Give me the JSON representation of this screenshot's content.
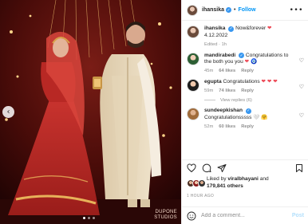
{
  "post": {
    "username": "ihansika",
    "follow_label": "Follow",
    "separator": "•",
    "more_label": "•••"
  },
  "caption": {
    "username": "ihansika",
    "text": "Now&forever ",
    "heart": "❤",
    "date": "4.12.2022",
    "meta": "Edited · 1h"
  },
  "comments": [
    {
      "username": "mandirabedi",
      "text": "Congratulations to the both you you ",
      "emoji": [
        "❤",
        "🧿"
      ],
      "time": "45m",
      "likes": "64 likes",
      "reply_label": "Reply"
    },
    {
      "username": "egupta",
      "text": "Congratulations ",
      "emoji": [
        "❤",
        "❤",
        "❤"
      ],
      "time": "59m",
      "likes": "74 likes",
      "reply_label": "Reply",
      "view_replies": "View replies (6)"
    },
    {
      "username": "sundeepkishan",
      "text": "Congratulationsssss ",
      "emoji": [
        "🤍",
        "🤗"
      ],
      "time": "52m",
      "likes": "60 likes",
      "reply_label": "Reply"
    }
  ],
  "likes": {
    "prefix": "Liked by ",
    "user": "viralbhayani",
    "and": " and",
    "count": "179,841 others"
  },
  "timestamp": "1 HOUR AGO",
  "add_comment": {
    "placeholder": "Add a comment...",
    "post_label": "Post"
  },
  "carousel": {
    "prev_icon": "chevron-left-icon",
    "slides": 3,
    "active_slide": 1,
    "watermark": "DUPONE\nSTUDIOS"
  },
  "colors": {
    "follow": "#0095f6",
    "verified": "#3897f0",
    "heart_red": "#ed4956",
    "muted": "#8e8e8e",
    "post_disabled": "#b2dffc"
  }
}
